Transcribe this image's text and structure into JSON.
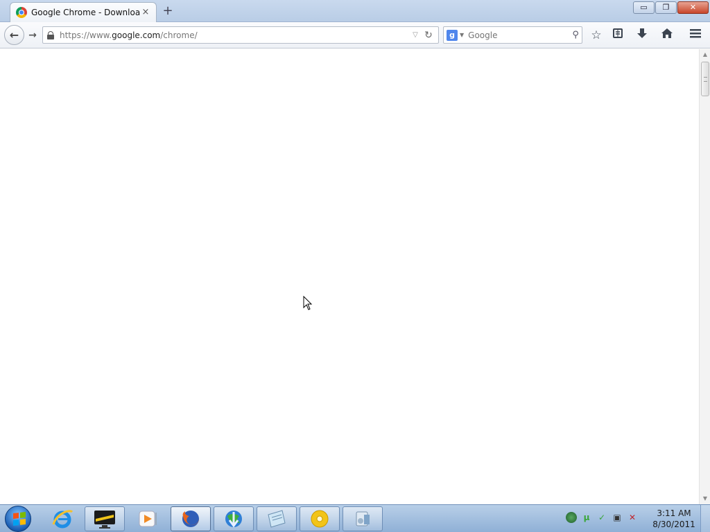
{
  "browser": {
    "tab": {
      "title": "Google Chrome - Downloa...",
      "close": "×"
    },
    "new_tab": "+",
    "window_controls": {
      "minimize": "▭",
      "restore": "❐",
      "close": "✕"
    },
    "nav": {
      "back": "←",
      "forward": "→"
    },
    "url": {
      "prefix": "https://www.",
      "domain": "google.com",
      "path": "/chrome/"
    },
    "search": {
      "engine_letter": "g",
      "placeholder": "Google"
    },
    "toolbar_icons": [
      "star-icon",
      "reading-list-icon",
      "download-icon",
      "home-icon",
      "menu-icon"
    ]
  },
  "taskbar": {
    "apps": [
      "internet-explorer",
      "monitor-app",
      "media-player",
      "firefox",
      "internet-download-manager",
      "notepad-app",
      "cd-disc-app",
      "control-panel-app"
    ],
    "clock": {
      "time": "3:11 AM",
      "date": "8/30/2011"
    }
  }
}
